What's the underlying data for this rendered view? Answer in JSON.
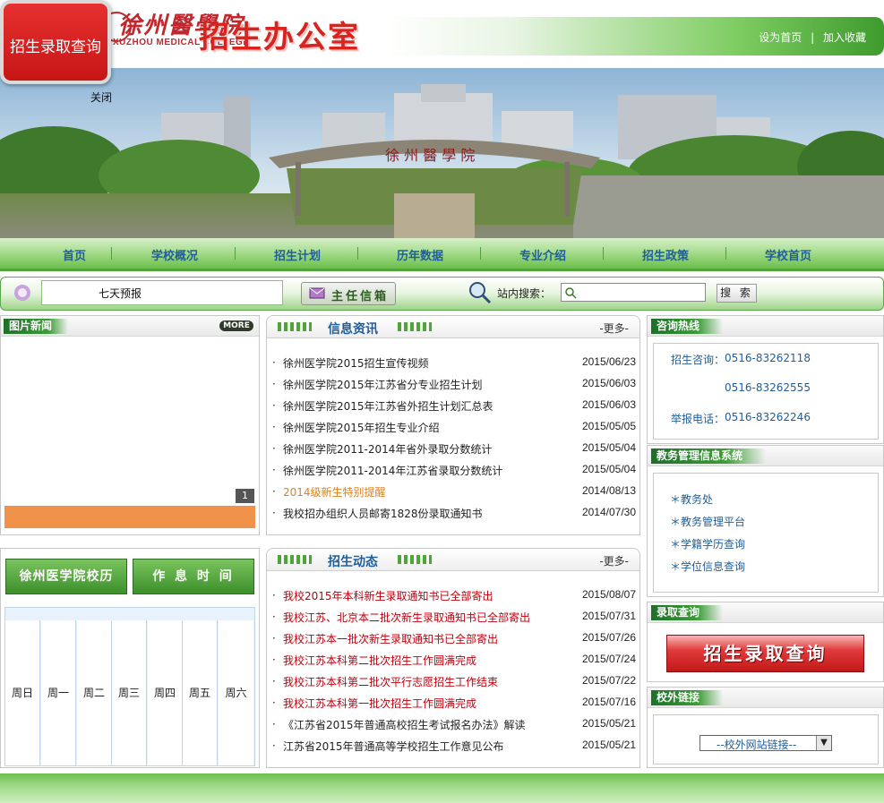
{
  "header": {
    "logo_script": "徐州醫學院",
    "logo_en": "XUZHOU MEDICAL COLLEGE",
    "site_title": "招生办公室",
    "top_links": [
      "设为首页",
      "|",
      "加入收藏"
    ]
  },
  "float_ad": {
    "label": "招生录取查询",
    "close": "关闭"
  },
  "banner": {
    "gate_text": "徐 州 醫 學 院"
  },
  "nav": {
    "items": [
      "首页",
      "学校概况",
      "招生计划",
      "历年数据",
      "专业介绍",
      "招生政策",
      "学校首页"
    ]
  },
  "toolbar": {
    "ticker": "七天预报",
    "mailbox": "主任信箱",
    "search_label": "站内搜索：",
    "search_placeholder": "",
    "search_button": "搜 索"
  },
  "photo_news": {
    "title": "图片新闻",
    "more": "MORE",
    "page_index": "1"
  },
  "left_buttons": {
    "history": "徐州医学院校历",
    "schedule": "作 息 时 间"
  },
  "calendar": {
    "weekdays": [
      "周日",
      "周一",
      "周二",
      "周三",
      "周四",
      "周五",
      "周六"
    ]
  },
  "info_news": {
    "title": "信息资讯",
    "more": "-更多-",
    "items": [
      {
        "title": "徐州医学院2015招生宣传视频",
        "date": "2015/06/23",
        "style": "normal"
      },
      {
        "title": "徐州医学院2015年江苏省分专业招生计划",
        "date": "2015/06/03",
        "style": "normal"
      },
      {
        "title": "徐州医学院2015年江苏省外招生计划汇总表",
        "date": "2015/06/03",
        "style": "normal"
      },
      {
        "title": "徐州医学院2015年招生专业介绍",
        "date": "2015/05/05",
        "style": "normal"
      },
      {
        "title": "徐州医学院2011-2014年省外录取分数统计",
        "date": "2015/05/04",
        "style": "normal"
      },
      {
        "title": "徐州医学院2011-2014年江苏省录取分数统计",
        "date": "2015/05/04",
        "style": "normal"
      },
      {
        "title": "2014级新生特别提醒",
        "date": "2014/08/13",
        "style": "orange"
      },
      {
        "title": "我校招办组织人员邮寄1828份录取通知书",
        "date": "2014/07/30",
        "style": "normal"
      }
    ]
  },
  "admission_news": {
    "title": "招生动态",
    "more": "-更多-",
    "items": [
      {
        "title": "我校2015年本科新生录取通知书已全部寄出",
        "date": "2015/08/07",
        "style": "red"
      },
      {
        "title": "我校江苏、北京本二批次新生录取通知书已全部寄出",
        "date": "2015/07/31",
        "style": "red"
      },
      {
        "title": "我校江苏本一批次新生录取通知书已全部寄出",
        "date": "2015/07/26",
        "style": "red"
      },
      {
        "title": "我校江苏本科第二批次招生工作圆满完成",
        "date": "2015/07/24",
        "style": "red"
      },
      {
        "title": "我校江苏本科第二批次平行志愿招生工作结束",
        "date": "2015/07/22",
        "style": "red"
      },
      {
        "title": "我校江苏本科第一批次招生工作圆满完成",
        "date": "2015/07/16",
        "style": "red"
      },
      {
        "title": "《江苏省2015年普通高校招生考试报名办法》解读",
        "date": "2015/05/21",
        "style": "normal"
      },
      {
        "title": "江苏省2015年普通高等学校招生工作意见公布",
        "date": "2015/05/21",
        "style": "normal"
      }
    ]
  },
  "hotline": {
    "title": "咨询热线",
    "consult_label": "招生咨询：",
    "consult_phone_1": "0516-83262118",
    "consult_phone_2": "0516-83262555",
    "report_label": "举报电话：",
    "report_phone": "0516-83262246"
  },
  "academic_system": {
    "title": "教务管理信息系统",
    "items": [
      "＊教务处",
      "＊教务管理平台",
      "＊学籍学历查询",
      "＊学位信息查询"
    ]
  },
  "admission_query": {
    "title": "录取查询",
    "banner_label": "招生录取查询"
  },
  "external_links": {
    "title": "校外链接",
    "select_value": "--校外网站链接--"
  },
  "colors": {
    "brand_green": "#4ea636",
    "brand_red": "#d9231f",
    "link_blue": "#1f5e9a",
    "alert_red": "#c0000c",
    "alert_orange": "#e0821f"
  }
}
